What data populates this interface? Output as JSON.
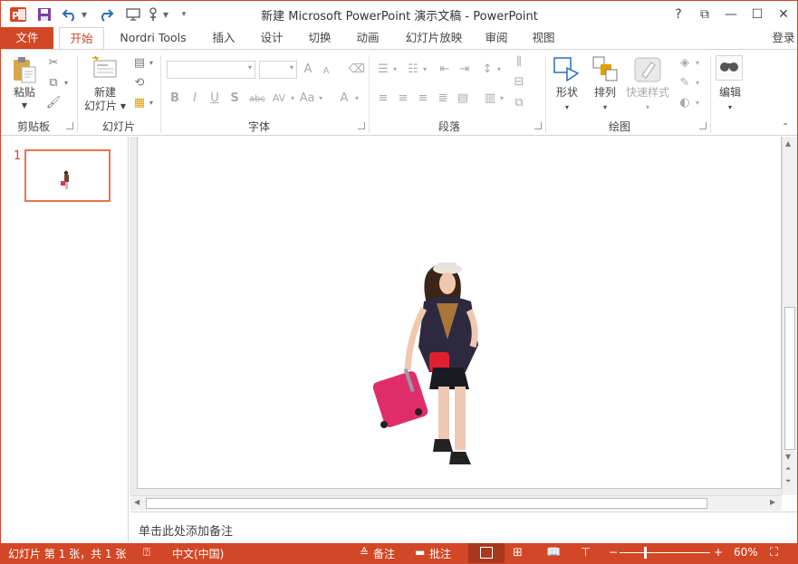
{
  "window": {
    "title": "新建 Microsoft PowerPoint 演示文稿 - PowerPoint"
  },
  "titlebar_buttons": {
    "help": "?",
    "restore": "⧉",
    "minimize": "—",
    "maximize": "☐",
    "close": "✕"
  },
  "tabs": [
    {
      "label": "文件"
    },
    {
      "label": "开始"
    },
    {
      "label": "Nordri Tools"
    },
    {
      "label": "插入"
    },
    {
      "label": "设计"
    },
    {
      "label": "切换"
    },
    {
      "label": "动画"
    },
    {
      "label": "幻灯片放映"
    },
    {
      "label": "审阅"
    },
    {
      "label": "视图"
    }
  ],
  "signin": "登录",
  "ribbon": {
    "clipboard": {
      "label": "剪贴板",
      "paste": "粘贴"
    },
    "slides": {
      "label": "幻灯片",
      "new_slide_1": "新建",
      "new_slide_2": "幻灯片"
    },
    "font": {
      "label": "字体",
      "bold": "B",
      "italic": "I",
      "underline": "U",
      "shadow": "S",
      "strike": "abc",
      "spacing": "AV",
      "case": "Aa",
      "color": "A",
      "grow": "A",
      "shrink": "A"
    },
    "paragraph": {
      "label": "段落"
    },
    "drawing": {
      "label": "绘图",
      "shapes": "形状",
      "arrange": "排列",
      "quick_styles": "快速样式"
    },
    "editing": {
      "label": "编辑"
    }
  },
  "slide_panel": {
    "number": "1"
  },
  "notes": {
    "placeholder": "单击此处添加备注"
  },
  "status": {
    "slide_info": "幻灯片 第 1 张，共 1 张",
    "language": "中文(中国)",
    "notes": "备注",
    "comments": "批注",
    "zoom": "60%",
    "zoom_level": 0.6
  },
  "colors": {
    "accent": "#d24726"
  }
}
